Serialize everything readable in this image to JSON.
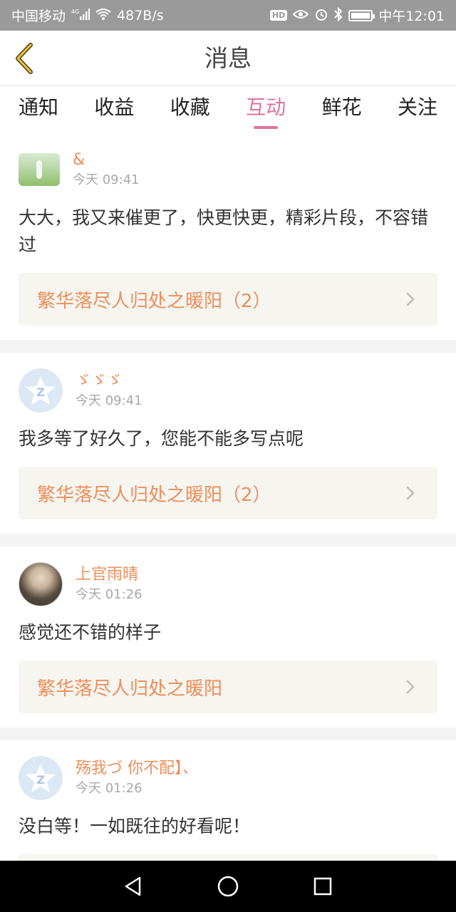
{
  "status_bar": {
    "carrier": "中国移动",
    "network": "4G",
    "speed": "487B/s",
    "time": "中午12:01",
    "battery_level": 0.9
  },
  "header": {
    "title": "消息",
    "back_icon": "chevron-left-icon"
  },
  "tabs": [
    {
      "label": "通知",
      "active": false
    },
    {
      "label": "收益",
      "active": false
    },
    {
      "label": "收藏",
      "active": false
    },
    {
      "label": "互动",
      "active": true
    },
    {
      "label": "鲜花",
      "active": false
    },
    {
      "label": "关注",
      "active": false
    }
  ],
  "messages": [
    {
      "username": "&",
      "time": "今天 09:41",
      "comment": "大大，我又来催更了，快更快更，精彩片段，不容错过",
      "book": "繁华落尽人归处之暖阳（2）"
    },
    {
      "username": "ゞゞゞ",
      "time": "今天 09:41",
      "comment": "我多等了好久了，您能不能多写点呢",
      "book": "繁华落尽人归处之暖阳（2）"
    },
    {
      "username": "上官雨晴",
      "time": "今天 01:26",
      "comment": "感觉还不错的样子",
      "book": "繁华落尽人归处之暖阳"
    },
    {
      "username": "殇我づ 你不配】、",
      "time": "今天 01:26",
      "comment": "没白等！一如既往的好看呢！",
      "book": ""
    }
  ],
  "colors": {
    "accent_pink": "#e0729c",
    "accent_orange": "#ec8f5c",
    "status_bar": "#9a9a9a"
  }
}
